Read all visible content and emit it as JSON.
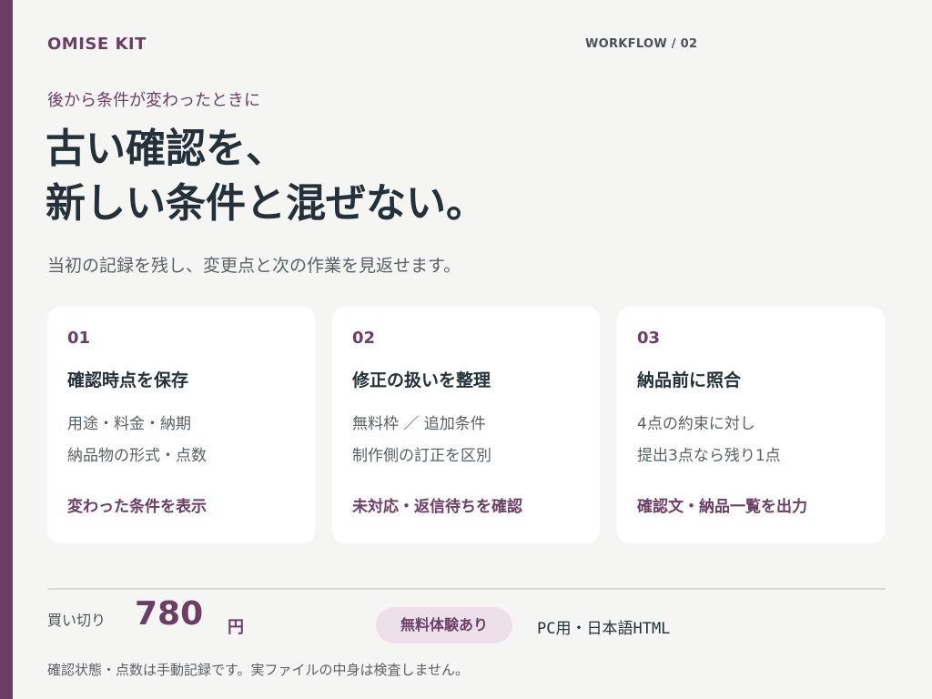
{
  "colors": {
    "accent": "#6b3f65",
    "background": "#f5f5f3",
    "card": "#ffffff",
    "text": "#24313a",
    "muted": "#5a6166",
    "badge_bg": "#ecdfea"
  },
  "header": {
    "brand": "OMISE KIT",
    "workflow": "WORKFLOW / 02"
  },
  "hero": {
    "eyebrow": "後から条件が変わったときに",
    "headline_lines": [
      "古い確認を、",
      "新しい条件と混ぜない。"
    ],
    "lead": "当初の記録を残し、変更点と次の作業を見返せます。"
  },
  "cards": [
    {
      "num": "01",
      "title": "確認時点を保存",
      "lines": [
        "用途・料金・納期",
        "納品物の形式・点数"
      ],
      "action": "変わった条件を表示"
    },
    {
      "num": "02",
      "title": "修正の扱いを整理",
      "lines": [
        "無料枠 ／ 追加条件",
        "制作側の訂正を区別"
      ],
      "action": "未対応・返信待ちを確認"
    },
    {
      "num": "03",
      "title": "納品前に照合",
      "lines": [
        "4点の約束に対し",
        "提出3点なら残り1点"
      ],
      "action": "確認文・納品一覧を出力"
    }
  ],
  "footer": {
    "buy_label": "買い切り",
    "price": "780",
    "currency": "円",
    "trial": "無料体験あり",
    "platform": "PC用・日本語HTML",
    "note": "確認状態・点数は手動記録です。実ファイルの中身は検査しません。"
  }
}
